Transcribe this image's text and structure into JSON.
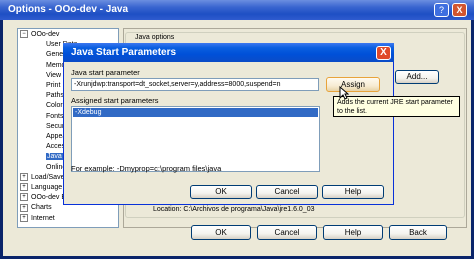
{
  "options_window": {
    "title": "Options - OOo-dev - Java",
    "help_btn": "?",
    "close_btn": "X",
    "tree": [
      {
        "label": "OOo-dev",
        "expander": "−",
        "level": 0
      },
      {
        "label": "User Data",
        "level": 2
      },
      {
        "label": "General",
        "level": 2
      },
      {
        "label": "Memory",
        "level": 2
      },
      {
        "label": "View",
        "level": 2
      },
      {
        "label": "Print",
        "level": 2
      },
      {
        "label": "Paths",
        "level": 2
      },
      {
        "label": "Colors",
        "level": 2
      },
      {
        "label": "Fonts",
        "level": 2
      },
      {
        "label": "Security",
        "level": 2
      },
      {
        "label": "Appearance",
        "level": 2
      },
      {
        "label": "Accessibility",
        "level": 2
      },
      {
        "label": "Java",
        "level": 2,
        "selected": true
      },
      {
        "label": "Online Update",
        "level": 2
      },
      {
        "label": "Load/Save",
        "expander": "+",
        "level": 0
      },
      {
        "label": "Language Settings",
        "expander": "+",
        "level": 0
      },
      {
        "label": "OOo-dev Base",
        "expander": "+",
        "level": 0
      },
      {
        "label": "Charts",
        "expander": "+",
        "level": 0
      },
      {
        "label": "Internet",
        "expander": "+",
        "level": 0
      }
    ],
    "java_options_label": "Java options",
    "add_btn": "Add...",
    "location": "Location: C:\\Archivos de programa\\Java\\jre1.6.0_03",
    "buttons": {
      "ok": "OK",
      "cancel": "Cancel",
      "help": "Help",
      "back": "Back"
    }
  },
  "dialog": {
    "title": "Java Start Parameters",
    "close_btn": "X",
    "param_label": "Java start parameter",
    "param_value": "-Xrunjdwp:transport=dt_socket,server=y,address=8000,suspend=n",
    "assign_btn": "Assign",
    "assigned_label": "Assigned start parameters",
    "assigned_items": [
      "-Xdebug"
    ],
    "example": "For example: -Dmyprop=c:\\program files\\java",
    "buttons": {
      "ok": "OK",
      "cancel": "Cancel",
      "help": "Help"
    }
  },
  "tooltip": "Adds the current JRE start parameter to the list."
}
